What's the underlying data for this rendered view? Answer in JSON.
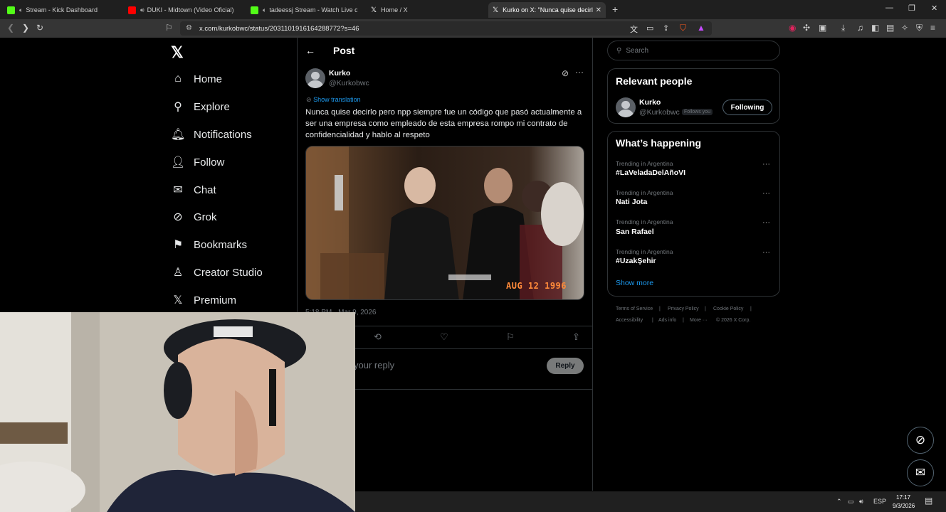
{
  "browser": {
    "tabs": [
      {
        "title": "Stream - Kick Dashboard",
        "favicon": "kick-icon",
        "color": "#53fc18"
      },
      {
        "title": "DUKI - Midtown (Video Oficial) -",
        "favicon": "youtube-icon",
        "color": "#ff0000"
      },
      {
        "title": "tadeessj Stream - Watch Live on",
        "favicon": "kick-icon",
        "color": "#53fc18"
      },
      {
        "title": "Home / X",
        "favicon": "x-icon",
        "color": "#ffffff"
      },
      {
        "title": "Kurko on X: \"Nunca quise decirl",
        "favicon": "x-icon",
        "color": "#ffffff",
        "active": true
      }
    ],
    "url": "x.com/kurkobwc/status/2031101916164288772?s=46"
  },
  "nav": {
    "items": [
      {
        "label": "Home",
        "icon": "home-icon",
        "glyph": "⌂"
      },
      {
        "label": "Explore",
        "icon": "search-icon",
        "glyph": "⚲"
      },
      {
        "label": "Notifications",
        "icon": "bell-icon",
        "glyph": "🔔︎"
      },
      {
        "label": "Follow",
        "icon": "add-person-icon",
        "glyph": "👤︎"
      },
      {
        "label": "Chat",
        "icon": "mail-icon",
        "glyph": "✉"
      },
      {
        "label": "Grok",
        "icon": "grok-icon",
        "glyph": "⊘"
      },
      {
        "label": "Bookmarks",
        "icon": "bookmark-icon",
        "glyph": "⚑"
      },
      {
        "label": "Creator Studio",
        "icon": "creator-icon",
        "glyph": "♙"
      },
      {
        "label": "Premium",
        "icon": "x-icon",
        "glyph": "𝕏"
      }
    ]
  },
  "post": {
    "header_title": "Post",
    "author_name": "Kurko",
    "author_handle": "@Kurkobwc",
    "show_translation": "Show translation",
    "text": "Nunca quise decirlo pero npp siempre fue un código que pasó actualmente a ser una empresa como empleado de esta empresa rompo mi contrato de confidencialidad y hablo al respeto",
    "image_date_stamp": "AUG 12 1996",
    "timestamp": "5:18 PM · Mar 9, 2026",
    "reply_placeholder": "your reply",
    "reply_button": "Reply"
  },
  "right": {
    "search_placeholder": "Search",
    "relevant_people": {
      "title": "Relevant people",
      "name": "Kurko",
      "handle": "@Kurkobwc",
      "follows_you": "Follows you",
      "following_button": "Following"
    },
    "whats_happening": {
      "title": "What’s happening",
      "trends": [
        {
          "context": "Trending in Argentina",
          "name": "#LaVeladaDelAñoVI"
        },
        {
          "context": "Trending in Argentina",
          "name": "Nati Jota"
        },
        {
          "context": "Trending in Argentina",
          "name": "San Rafael"
        },
        {
          "context": "Trending in Argentina",
          "name": "#UzakŞehir"
        }
      ],
      "show_more": "Show more"
    },
    "footer": [
      "Terms of Service",
      "|",
      "Privacy Policy",
      "|",
      "Cookie Policy",
      "|",
      "Accessibility",
      "|",
      "Ads info",
      "|",
      "More ···",
      "© 2026 X Corp."
    ]
  },
  "taskbar": {
    "lang": "ESP",
    "time": "17:17",
    "date": "9/3/2026"
  }
}
